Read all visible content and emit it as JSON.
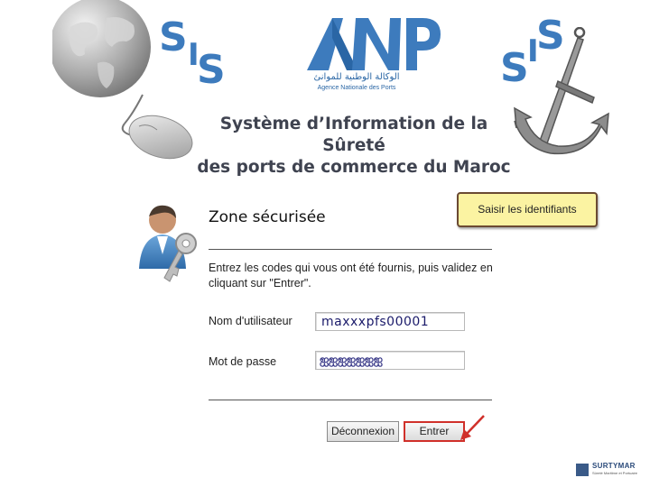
{
  "branding": {
    "sis_letters": [
      "S",
      "I",
      "S"
    ],
    "anp_logo_text": "ANP",
    "anp_arabic": "الوكالة الوطنية للموانئ",
    "anp_subtitle": "Agence Nationale des Ports",
    "main_title_line1": "Système d’Information de la Sûreté",
    "main_title_line2": "des ports de commerce du Maroc"
  },
  "callout": {
    "text": "Saisir les identifiants"
  },
  "login": {
    "title": "Zone sécurisée",
    "instructions": "Entrez les codes qui vous ont été fournis, puis validez en cliquant sur \"Entrer\".",
    "username_label": "Nom d'utilisateur",
    "username_value": "maxxxpfs00001",
    "password_label": "Mot de passe",
    "password_value": "ஐஐஐஐஐஐஐ",
    "logout_button": "Déconnexion",
    "enter_button": "Entrer"
  },
  "footer": {
    "logo_text": "SURTYMAR",
    "logo_subtitle": "Sûreté Maritime et Portuaire"
  },
  "colors": {
    "brand_blue": "#3d7bbd",
    "callout_bg": "#fbf3a2",
    "highlight_red": "#d0302a"
  }
}
